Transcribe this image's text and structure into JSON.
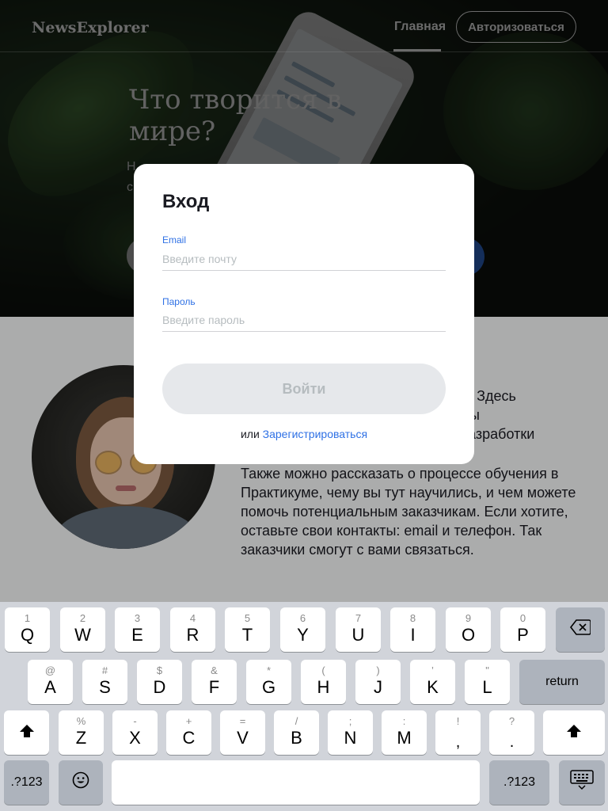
{
  "header": {
    "logo": "NewsExplorer",
    "nav_home": "Главная",
    "nav_auth": "Авторизоваться"
  },
  "hero": {
    "title": "Что творится в мире?",
    "subtitle_fragment_1": "Н",
    "subtitle_fragment_2": "с"
  },
  "about": {
    "line1_tail": "кта. Здесь",
    "line2_tail": "м вы",
    "line3_tail": "и разработки",
    "paragraph2": "Также можно рассказать о процессе обучения в Практикуме, чему вы тут научились, и чем можете помочь потенциальным заказчикам. Если хотите, оставьте свои контакты: email и телефон. Так заказчики смогут с вами связаться."
  },
  "modal": {
    "title": "Вход",
    "email_label": "Email",
    "email_placeholder": "Введите почту",
    "email_value": "",
    "password_label": "Пароль",
    "password_placeholder": "Введите пароль",
    "password_value": "",
    "submit_label": "Войти",
    "alt_prefix": "или",
    "register_link": "Зарегистрироваться"
  },
  "colors": {
    "accent": "#2f71e5",
    "text": "#1a1b22",
    "disabled_button": "#e6e8eb"
  },
  "keyboard": {
    "row1": [
      {
        "main": "Q",
        "sub": "1"
      },
      {
        "main": "W",
        "sub": "2"
      },
      {
        "main": "E",
        "sub": "3"
      },
      {
        "main": "R",
        "sub": "4"
      },
      {
        "main": "T",
        "sub": "5"
      },
      {
        "main": "Y",
        "sub": "6"
      },
      {
        "main": "U",
        "sub": "7"
      },
      {
        "main": "I",
        "sub": "8"
      },
      {
        "main": "O",
        "sub": "9"
      },
      {
        "main": "P",
        "sub": "0"
      }
    ],
    "row2": [
      {
        "main": "A",
        "sub": "@"
      },
      {
        "main": "S",
        "sub": "#"
      },
      {
        "main": "D",
        "sub": "$"
      },
      {
        "main": "F",
        "sub": "&"
      },
      {
        "main": "G",
        "sub": "*"
      },
      {
        "main": "H",
        "sub": "("
      },
      {
        "main": "J",
        "sub": ")"
      },
      {
        "main": "K",
        "sub": "’"
      },
      {
        "main": "L",
        "sub": "\""
      }
    ],
    "row3": [
      {
        "main": "Z",
        "sub": "%"
      },
      {
        "main": "X",
        "sub": "-"
      },
      {
        "main": "C",
        "sub": "+"
      },
      {
        "main": "V",
        "sub": "="
      },
      {
        "main": "B",
        "sub": "/"
      },
      {
        "main": "N",
        "sub": ";"
      },
      {
        "main": "M",
        "sub": ":"
      },
      {
        "main": ",",
        "sub": "!"
      },
      {
        "main": ".",
        "sub": "?"
      }
    ],
    "return_label": "return",
    "numbers_label": ".?123",
    "backspace_icon": "backspace-icon",
    "shift_icon": "shift-icon",
    "emoji_icon": "emoji-icon",
    "hide_keyboard_icon": "keyboard-hide-icon"
  }
}
